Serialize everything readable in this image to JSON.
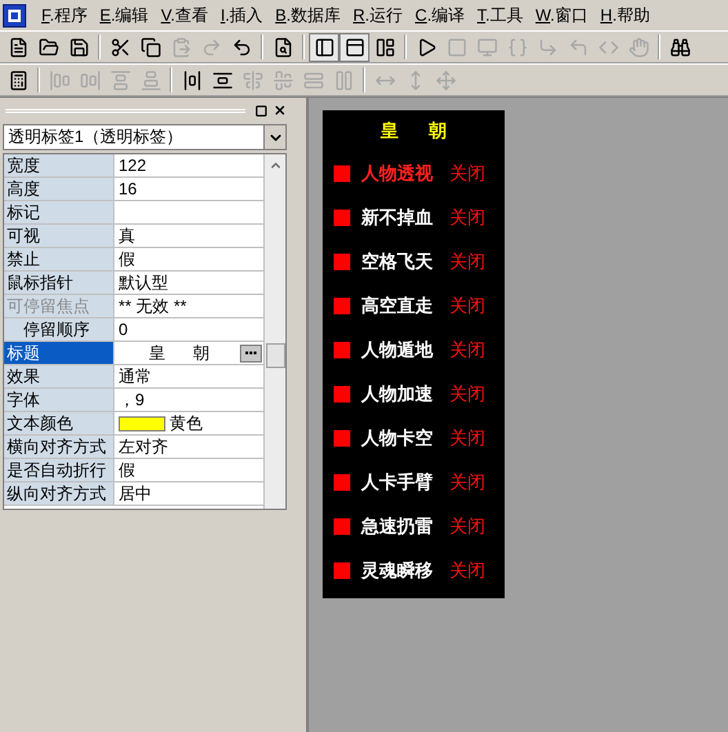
{
  "menu": [
    {
      "label": "F.程序"
    },
    {
      "label": "E.编辑"
    },
    {
      "label": "V.查看"
    },
    {
      "label": "I.插入"
    },
    {
      "label": "B.数据库"
    },
    {
      "label": "R.运行"
    },
    {
      "label": "C.编译"
    },
    {
      "label": "T.工具"
    },
    {
      "label": "W.窗口"
    },
    {
      "label": "H.帮助"
    }
  ],
  "toolbar_1": [
    [
      {
        "disabled": false,
        "pressed": false
      },
      {
        "disabled": false,
        "pressed": false
      },
      {
        "disabled": false,
        "pressed": false
      }
    ],
    [
      {
        "disabled": false,
        "pressed": false
      },
      {
        "disabled": false,
        "pressed": false
      },
      {
        "disabled": true,
        "pressed": false
      },
      {
        "disabled": true,
        "pressed": false
      },
      {
        "disabled": false,
        "pressed": false
      }
    ],
    [
      {
        "disabled": false,
        "pressed": false
      }
    ],
    [
      {
        "disabled": false,
        "pressed": true
      },
      {
        "disabled": false,
        "pressed": true
      },
      {
        "disabled": false,
        "pressed": false
      }
    ],
    [
      {
        "disabled": false,
        "pressed": false
      },
      {
        "disabled": true,
        "pressed": false
      },
      {
        "disabled": true,
        "pressed": false
      },
      {
        "disabled": true,
        "pressed": false
      },
      {
        "disabled": true,
        "pressed": false
      },
      {
        "disabled": true,
        "pressed": false
      },
      {
        "disabled": true,
        "pressed": false
      },
      {
        "disabled": true,
        "pressed": false
      }
    ],
    [
      {
        "disabled": false,
        "pressed": false
      }
    ]
  ],
  "toolbar_2": [
    [
      {
        "disabled": false
      }
    ],
    [
      {
        "disabled": true
      },
      {
        "disabled": true
      },
      {
        "disabled": true
      },
      {
        "disabled": true
      }
    ],
    [
      {
        "disabled": false
      },
      {
        "disabled": false
      },
      {
        "disabled": true
      },
      {
        "disabled": true
      },
      {
        "disabled": true
      },
      {
        "disabled": true
      }
    ],
    [
      {
        "disabled": true
      },
      {
        "disabled": true
      },
      {
        "disabled": true
      }
    ]
  ],
  "property_panel": {
    "object_select": "透明标签1（透明标签）",
    "properties": [
      {
        "name": "宽度",
        "value": "122",
        "kind": "text",
        "selected": false,
        "disabled": false
      },
      {
        "name": "高度",
        "value": "16",
        "kind": "text",
        "selected": false,
        "disabled": false
      },
      {
        "name": "标记",
        "kind": "text",
        "selected": false,
        "disabled": false
      },
      {
        "name": "可视",
        "value": "真",
        "kind": "text",
        "selected": false,
        "disabled": false
      },
      {
        "name": "禁止",
        "value": "假",
        "kind": "text",
        "selected": false,
        "disabled": false
      },
      {
        "name": "鼠标指针",
        "value": "默认型",
        "kind": "text",
        "selected": false,
        "disabled": false
      },
      {
        "name": "可停留焦点",
        "value": "** 无效 **",
        "kind": "text",
        "selected": false,
        "disabled": true,
        "children": [
          {
            "name": "停留顺序",
            "value": "0",
            "kind": "text",
            "selected": false,
            "disabled": false
          }
        ]
      },
      {
        "name": "标题",
        "value": "皇      朝",
        "kind": "ellipsis",
        "selected": true,
        "disabled": false
      },
      {
        "name": "效果",
        "value": "通常",
        "kind": "text",
        "selected": false,
        "disabled": false
      },
      {
        "name": "字体",
        "value": "，9",
        "kind": "text",
        "selected": false,
        "disabled": false
      },
      {
        "name": "文本颜色",
        "value": "黄色",
        "kind": "color",
        "color": "#ffff00",
        "selected": false,
        "disabled": false
      },
      {
        "name": "横向对齐方式",
        "value": "左对齐",
        "kind": "text",
        "selected": false,
        "disabled": false
      },
      {
        "name": "是否自动折行",
        "value": "假",
        "kind": "text",
        "selected": false,
        "disabled": false
      },
      {
        "name": "纵向对齐方式",
        "value": "居中",
        "kind": "text",
        "selected": false,
        "disabled": false
      }
    ]
  },
  "form": {
    "title": "皇      朝",
    "features": [
      {
        "name": "人物透视",
        "status": "关闭",
        "highlighted": true
      },
      {
        "name": "新不掉血",
        "status": "关闭",
        "highlighted": false
      },
      {
        "name": "空格飞天",
        "status": "关闭",
        "highlighted": false
      },
      {
        "name": "高空直走",
        "status": "关闭",
        "highlighted": false
      },
      {
        "name": "人物遁地",
        "status": "关闭",
        "highlighted": false
      },
      {
        "name": "人物加速",
        "status": "关闭",
        "highlighted": false
      },
      {
        "name": "人物卡空",
        "status": "关闭",
        "highlighted": false
      },
      {
        "name": "人卡手臂",
        "status": "关闭",
        "highlighted": false
      },
      {
        "name": "急速扔雷",
        "status": "关闭",
        "highlighted": false
      },
      {
        "name": "灵魂瞬移",
        "status": "关闭",
        "highlighted": false
      }
    ]
  }
}
